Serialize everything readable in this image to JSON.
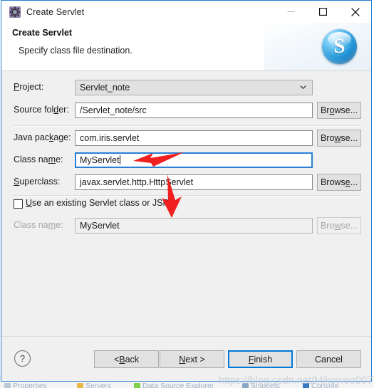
{
  "window": {
    "title": "Create Servlet",
    "icon": "servlet-gear-icon",
    "controls": {
      "minimize": "minimize-icon",
      "maximize": "maximize-icon",
      "close": "close-icon"
    },
    "accent_color": "#2a7fd4"
  },
  "header": {
    "title": "Create Servlet",
    "subtitle": "Specify class file destination.",
    "logo_letter": "S",
    "logo_color": "#2095d8"
  },
  "form": {
    "project": {
      "label_pre": "P",
      "label_post": "roject:",
      "value": "Servlet_note",
      "control": "combo"
    },
    "source_folder": {
      "label_pre": "Source fol",
      "label_mn": "d",
      "label_post": "er:",
      "value": "/Servlet_note/src",
      "browse": {
        "pre": "Br",
        "mn": "o",
        "post": "wse..."
      }
    },
    "java_package": {
      "label_pre": "Java pac",
      "label_mn": "k",
      "label_post": "age:",
      "value": "com.iris.servlet",
      "browse": {
        "pre": "Bro",
        "mn": "w",
        "post": "se..."
      }
    },
    "class_name": {
      "label_pre": "Class na",
      "label_mn": "m",
      "label_post": "e:",
      "value": "MyServlet",
      "focused": true
    },
    "superclass": {
      "label_pre": "S",
      "label_post": "uperclass:",
      "value": "javax.servlet.http.HttpServlet",
      "browse": {
        "pre": "Brows",
        "mn": "e",
        "post": "..."
      }
    },
    "use_existing": {
      "checked": false,
      "label_pre": "U",
      "label_post": "se an existing Servlet class or JSP"
    },
    "existing_class_name": {
      "label_pre": "Class na",
      "label_mn": "m",
      "label_post": "e:",
      "value": "MyServlet",
      "disabled": true,
      "browse": {
        "pre": "Bro",
        "mn": "w",
        "post": "se..."
      }
    }
  },
  "footer": {
    "help_icon": "question-mark-icon",
    "back": {
      "pre": "< ",
      "mn": "B",
      "post": "ack"
    },
    "next": {
      "pre": "",
      "mn": "N",
      "post": "ext >"
    },
    "finish": {
      "pre": "",
      "mn": "F",
      "post": "inish",
      "default": true
    },
    "cancel": {
      "pre": "Cancel",
      "mn": "",
      "post": ""
    }
  },
  "annotations": {
    "arrow_class_name": "red-arrow-pointing-at-class-name-field",
    "arrow_next": "red-arrow-pointing-at-next-button",
    "arrow_color": "#f02020"
  },
  "watermark": "https://blog.csdn.net/Mikowoo007",
  "background_tabs": [
    {
      "label": "Properties",
      "color": "#b9c9d8"
    },
    {
      "label": "Servers",
      "color": "#e8b84b"
    },
    {
      "label": "Data Source Explorer",
      "color": "#7fd04a"
    },
    {
      "label": "Snippets",
      "color": "#88a9c6"
    },
    {
      "label": "Console",
      "color": "#3b78c2"
    }
  ]
}
